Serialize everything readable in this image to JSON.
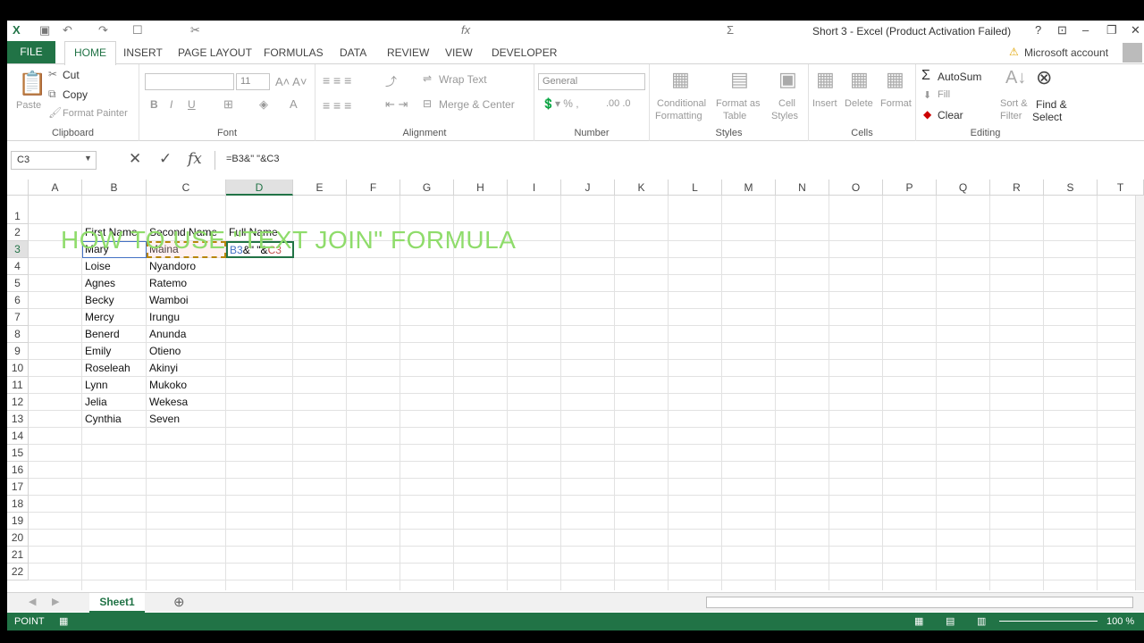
{
  "app": {
    "title": "Short 3 - Excel (Product Activation Failed)",
    "account": "Microsoft account"
  },
  "tabs": [
    "FILE",
    "HOME",
    "INSERT",
    "PAGE LAYOUT",
    "FORMULAS",
    "DATA",
    "REVIEW",
    "VIEW",
    "DEVELOPER"
  ],
  "ribbon": {
    "clipboard": {
      "label": "Clipboard",
      "paste": "Paste",
      "cut": "Cut",
      "copy": "Copy",
      "painter": "Format Painter"
    },
    "font": {
      "label": "Font",
      "size": "11"
    },
    "alignment": {
      "label": "Alignment",
      "wrap": "Wrap Text",
      "merge": "Merge & Center"
    },
    "number": {
      "label": "Number",
      "format": "General"
    },
    "styles": {
      "label": "Styles",
      "cond1": "Conditional",
      "cond2": "Formatting",
      "fmt1": "Format as",
      "fmt2": "Table",
      "cell1": "Cell",
      "cell2": "Styles"
    },
    "cells": {
      "label": "Cells",
      "insert": "Insert",
      "delete": "Delete",
      "format": "Format"
    },
    "editing": {
      "label": "Editing",
      "autosum": "AutoSum",
      "fill": "Fill",
      "clear": "Clear",
      "sort1": "Sort &",
      "sort2": "Filter",
      "find1": "Find &",
      "find2": "Select"
    }
  },
  "formula_bar": {
    "name_box": "C3",
    "formula": "=B3&\" \"&C3"
  },
  "columns": [
    "A",
    "B",
    "C",
    "D",
    "E",
    "F",
    "G",
    "H",
    "I",
    "J",
    "K",
    "L",
    "M",
    "N",
    "O",
    "P",
    "Q",
    "R",
    "S",
    "T"
  ],
  "rows": [
    "1",
    "2",
    "3",
    "4",
    "5",
    "6",
    "7",
    "8",
    "9",
    "10",
    "11",
    "12",
    "13",
    "14",
    "15",
    "16",
    "17",
    "18",
    "19",
    "20",
    "21",
    "22"
  ],
  "sheet_title": "HOW TO USE \"TEXT JOIN\"  FORMULA",
  "headers": {
    "b": "First Name",
    "c": "Second Name",
    "d": "Full Name"
  },
  "names": [
    {
      "first": "Mary",
      "second": "Maina"
    },
    {
      "first": "Loise",
      "second": "Nyandoro"
    },
    {
      "first": "Agnes",
      "second": "Ratemo"
    },
    {
      "first": "Becky",
      "second": "Wamboi"
    },
    {
      "first": "Mercy",
      "second": "Irungu"
    },
    {
      "first": "Benerd",
      "second": "Anunda"
    },
    {
      "first": "Emily",
      "second": "Otieno"
    },
    {
      "first": "Roseleah",
      "second": "Akinyi"
    },
    {
      "first": "Lynn",
      "second": "Mukoko"
    },
    {
      "first": "Jelia",
      "second": "Wekesa"
    },
    {
      "first": "Cynthia",
      "second": "Seven"
    }
  ],
  "edit_cell": {
    "ref1": "B3",
    "mid": "&\" \"&",
    "ref2": "C3"
  },
  "sheet_tab": "Sheet1",
  "status": {
    "mode": "POINT",
    "zoom": "100 %"
  },
  "colors": {
    "excel_green": "#217346",
    "title_green": "#8fdc6b"
  }
}
